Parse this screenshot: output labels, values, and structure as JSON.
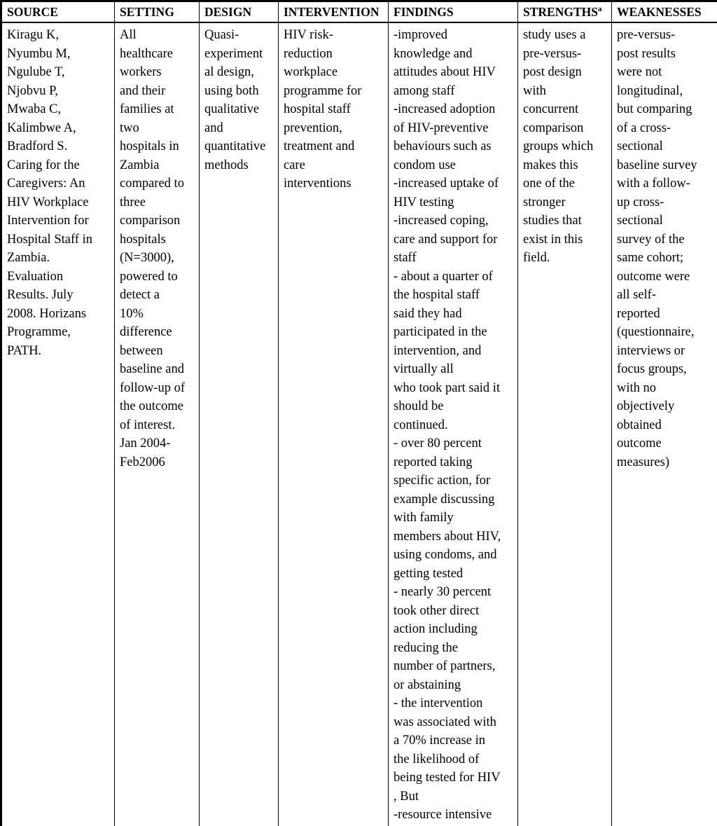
{
  "table": {
    "caption_note_marker": "a",
    "columns": [
      {
        "key": "source",
        "label": "SOURCE"
      },
      {
        "key": "setting",
        "label": "SETTING"
      },
      {
        "key": "design",
        "label": "DESIGN"
      },
      {
        "key": "intervention",
        "label": "INTERVENTION"
      },
      {
        "key": "findings",
        "label": "FINDINGS"
      },
      {
        "key": "strengths",
        "label": "STRENGTHS"
      },
      {
        "key": "weaknesses",
        "label": "WEAKNESSES"
      }
    ],
    "rows": [
      {
        "source": "Kiragu K, Nyumbu M, Ngulube T, Njobvu P, Mwaba C, Kalimbwe A, Bradford S. Caring for the Caregivers: An HIV Workplace Intervention for Hospital Staff in Zambia. Evaluation Results. July 2008. Horizans Programme, PATH.",
        "source_lines": [
          "Kiragu K,",
          "Nyumbu M,",
          "Ngulube T,",
          "Njobvu P,",
          "Mwaba C,",
          "Kalimbwe A,",
          "Bradford S.",
          "Caring for the",
          "Caregivers: An",
          "HIV Workplace",
          "Intervention for",
          "Hospital Staff in",
          "Zambia.",
          "Evaluation",
          "Results. July",
          "2008. Horizans",
          "Programme,",
          "PATH."
        ],
        "setting": "All healthcare workers and their families at two hospitals in Zambia compared to three comparison hospitals (N=3000), powered to detect a 10% difference between baseline and follow-up of the outcome of interest. Jan 2004-Feb2006",
        "setting_lines": [
          "All",
          "healthcare",
          "workers",
          "and their",
          "families at",
          "two",
          "hospitals in",
          "Zambia",
          "compared to",
          "three",
          "comparison",
          "hospitals",
          "(N=3000),",
          "powered to",
          "detect a",
          "10%",
          "difference",
          "between",
          "baseline and",
          "follow-up of",
          "the outcome",
          "of interest.",
          "Jan 2004-",
          "Feb2006"
        ],
        "design": "Quasi-experimental design, using both qualitative and quantitative methods",
        "design_lines": [
          "Quasi-",
          "experiment",
          "al design,",
          "using both",
          "qualitative",
          "and",
          "quantitative",
          "methods"
        ],
        "intervention": "HIV risk-reduction workplace programme for hospital staff prevention, treatment and care interventions",
        "intervention_lines": [
          "HIV risk-",
          "reduction",
          "workplace",
          "programme for",
          "hospital staff",
          "prevention,",
          "treatment and",
          "care",
          "interventions"
        ],
        "findings": "-improved knowledge and attitudes about HIV among staff -increased adoption of HIV-preventive behaviours such as condom use -increased uptake of HIV testing -increased coping, care and support for staff - about a quarter of the hospital staff said they had participated in the intervention, and virtually all who took part said it should be continued. - over 80 percent reported taking specific action, for example discussing with family members about HIV, using condoms, and getting tested - nearly 30 percent took other direct action including reducing the number of partners, or abstaining - the intervention was associated with a 70% increase in the likelihood of being tested for HIV , But -resource intensive",
        "findings_lines": [
          "-improved",
          "knowledge and",
          "attitudes about HIV",
          "among staff",
          "-increased adoption",
          "of HIV-preventive",
          "behaviours such as",
          "condom use",
          "-increased uptake of",
          "HIV testing",
          "-increased coping,",
          "care and support for",
          "staff",
          "- about a quarter of",
          "the hospital staff",
          "said they had",
          "participated in the",
          "intervention, and",
          "virtually all",
          "who took part said it",
          "should be",
          "continued.",
          "- over 80 percent",
          "reported taking",
          "specific action, for",
          "example discussing",
          "with family",
          "members about HIV,",
          "using condoms, and",
          "getting tested",
          "- nearly 30 percent",
          "took other direct",
          "action including",
          "reducing the",
          "number of partners,",
          "or abstaining",
          "- the intervention",
          "was associated with",
          "a 70% increase in",
          "the likelihood of",
          "being tested for HIV",
          ", But",
          "-resource intensive"
        ],
        "strengths": "study uses a pre-versus-post design with concurrent comparison groups which makes this one of the stronger studies that exist in this field.",
        "strengths_lines": [
          "study uses a",
          "pre-versus-",
          "post design",
          "with",
          "concurrent",
          "comparison",
          "groups which",
          "makes this",
          "one of the",
          "stronger",
          "studies that",
          "exist in this",
          "field."
        ],
        "weaknesses": "pre-versus-post results were not longitudinal, but comparing of a cross-sectional baseline survey with a follow-up cross-sectional survey of the same cohort; outcome were all self-reported (questionnaire, interviews or focus groups, with no objectively obtained outcome measures)",
        "weaknesses_lines": [
          "pre-versus-",
          "post results",
          "were not",
          "longitudinal,",
          "but comparing",
          "of a cross-",
          "sectional",
          "baseline survey",
          "with a follow-",
          "up cross-",
          "sectional",
          "survey of the",
          "same cohort;",
          "outcome were",
          "all self-",
          "reported",
          "(questionnaire,",
          "interviews or",
          "focus groups,",
          "with no",
          "objectively",
          "obtained",
          "outcome",
          "measures)"
        ]
      }
    ]
  }
}
